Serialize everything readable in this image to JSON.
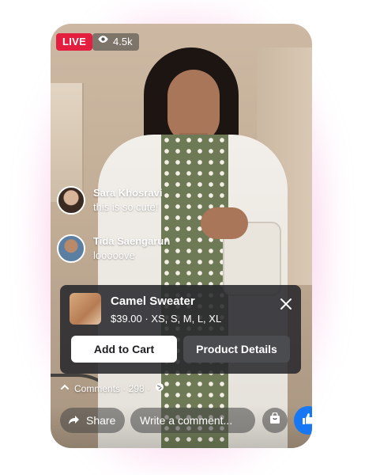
{
  "live": {
    "badge": "LIVE",
    "viewers": "4.5k"
  },
  "comments": [
    {
      "name": "Sara Khosravi",
      "text": "this is so cute!"
    },
    {
      "name": "Tida Saengarun",
      "text": "looooove"
    }
  ],
  "product": {
    "name": "Camel Sweater",
    "price_sizes": "$39.00 · XS, S, M, L, XL",
    "add_to_cart": "Add to Cart",
    "details": "Product Details"
  },
  "footer": {
    "comments_label": "Comments · 298 ·",
    "share_label": "Share",
    "comment_placeholder": "Write a comment..."
  },
  "colors": {
    "live": "#e41e3f",
    "like": "#1877f2",
    "card": "#28282c"
  },
  "icons": [
    "eye-icon",
    "close-icon",
    "chevron-up-icon",
    "globe-icon",
    "share-arrow-icon",
    "shop-bag-icon",
    "thumbs-up-icon"
  ]
}
